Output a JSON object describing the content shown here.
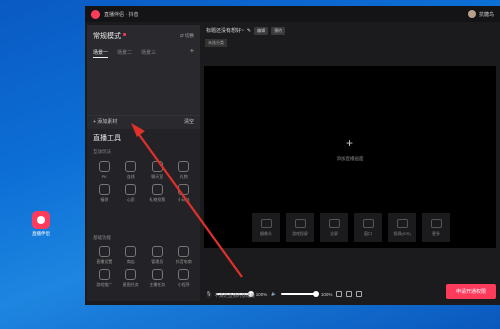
{
  "desktop": {
    "icon_label": "直播伴侣"
  },
  "titlebar": {
    "title": "直播伴侣 · 抖音",
    "username": "抗糖鸟"
  },
  "left": {
    "mode_title": "常规模式",
    "switch_label": "⇄ 切换",
    "scenes": [
      "场景一",
      "场景二",
      "场景三"
    ],
    "add_material": "+ 添加素材",
    "clear": "清空",
    "tools_title": "直播工具",
    "group1_label": "互动玩法",
    "group1_tools": [
      "PK",
      "连线",
      "聊天室",
      "礼物",
      "福袋",
      "心愿",
      "礼物投票",
      "小玩法"
    ],
    "group2_label": "基础功能",
    "group2_tools": [
      "直播设置",
      "商店",
      "管理员",
      "抖音电商",
      "游戏推广",
      "星图任务",
      "主播任务",
      "小程序"
    ]
  },
  "main": {
    "stream_title": "标题还没有想好~",
    "edit_tag": "编辑",
    "subscribe_tag": "预约",
    "category_tag": "未选分类",
    "canvas_hint": "添加直播画面",
    "quick_sources": [
      "摄像头",
      "游戏投屏",
      "全屏",
      "窗口",
      "投屏(iOS)",
      "更多"
    ],
    "mic_level": "100%",
    "speaker_level": "100%",
    "go_live": "申请开通权限",
    "status_text": "不满足直播的基础能"
  }
}
